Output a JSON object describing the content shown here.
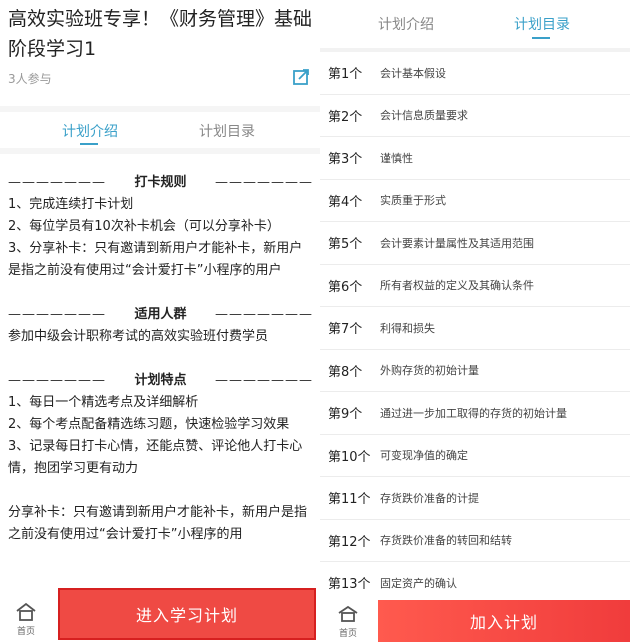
{
  "left": {
    "title": "高效实验班专享！《财务管理》基础阶段学习1",
    "participants": "3人参与",
    "tabs": {
      "intro": "计划介绍",
      "catalog": "计划目录"
    },
    "sections": {
      "rules": {
        "heading": "打卡规则",
        "lines": [
          "1、完成连续打卡计划",
          "2、每位学员有10次补卡机会（可以分享补卡）",
          "3、分享补卡：只有邀请到新用户才能补卡，新用户是指之前没有使用过“会计爱打卡”小程序的用户"
        ]
      },
      "audience": {
        "heading": "适用人群",
        "lines": [
          "参加中级会计职称考试的高效实验班付费学员"
        ]
      },
      "features": {
        "heading": "计划特点",
        "lines": [
          "1、每日一个精选考点及详细解析",
          "2、每个考点配备精选练习题，快速检验学习效果",
          "3、记录每日打卡心情，还能点赞、评论他人打卡心情，抱团学习更有动力"
        ]
      },
      "share_note": "分享补卡：只有邀请到新用户才能补卡，新用户是指之前没有使用过“会计爱打卡”小程序的用"
    },
    "dash": "———————",
    "home_label": "首页",
    "enter_button": "进入学习计划"
  },
  "right": {
    "tabs": {
      "intro": "计划介绍",
      "catalog": "计划目录"
    },
    "items": [
      {
        "num": "第1个",
        "text": "会计基本假设"
      },
      {
        "num": "第2个",
        "text": "会计信息质量要求"
      },
      {
        "num": "第3个",
        "text": "谨慎性"
      },
      {
        "num": "第4个",
        "text": "实质重于形式"
      },
      {
        "num": "第5个",
        "text": "会计要素计量属性及其适用范围"
      },
      {
        "num": "第6个",
        "text": "所有者权益的定义及其确认条件"
      },
      {
        "num": "第7个",
        "text": "利得和损失"
      },
      {
        "num": "第8个",
        "text": "外购存货的初始计量"
      },
      {
        "num": "第9个",
        "text": "通过进一步加工取得的存货的初始计量"
      },
      {
        "num": "第10个",
        "text": "可变现净值的确定"
      },
      {
        "num": "第11个",
        "text": "存货跌价准备的计提"
      },
      {
        "num": "第12个",
        "text": "存货跌价准备的转回和结转"
      },
      {
        "num": "第13个",
        "text": "固定资产的确认"
      }
    ],
    "home_label": "首页",
    "join_button": "加入计划"
  },
  "colors": {
    "accent": "#3aa0c9",
    "cta": "#ef4a44"
  },
  "icons": {
    "share": "share-icon",
    "home": "home-icon"
  }
}
